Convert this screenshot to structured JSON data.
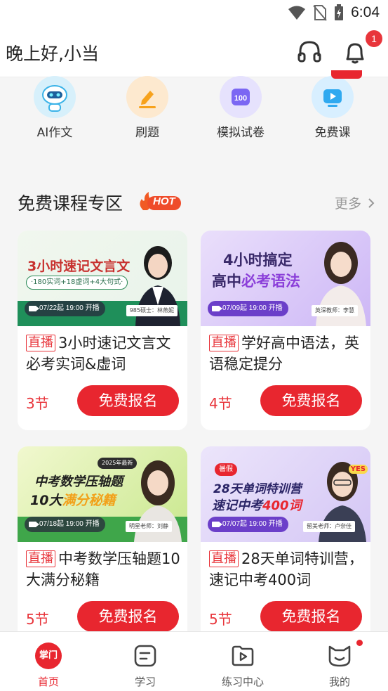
{
  "status": {
    "time": "6:04"
  },
  "header": {
    "greeting": "晚上好,小当",
    "notification_count": "1"
  },
  "quick_nav": [
    {
      "label": "AI作文",
      "icon": "robot-icon",
      "color": "#3bb3e8"
    },
    {
      "label": "刷题",
      "icon": "pen-icon",
      "color": "#f7a21c"
    },
    {
      "label": "模拟试卷",
      "icon": "score-100-icon",
      "color": "#6f5cf0"
    },
    {
      "label": "免费课",
      "icon": "play-icon",
      "color": "#29a8ef"
    }
  ],
  "section": {
    "title": "免费课程专区",
    "hot_label": "HOT",
    "more_label": "更多"
  },
  "courses": [
    {
      "banner_title": "3小时速记文言文",
      "banner_sub": "·180实词+18虚词+4大句式·",
      "date": "07/22起 19:00 开播",
      "teacher": "985硕士：林燕妮",
      "tag": "直播",
      "title": "3小时速记文言文必考实词&虚词",
      "lessons": "3节",
      "button": "免费报名"
    },
    {
      "banner_title_1": "4小时搞定",
      "banner_title_2a": "高中",
      "banner_title_2b": "必考语法",
      "date": "07/09起 19:00 开播",
      "teacher": "英深教师：李慧",
      "tag": "直播",
      "title": "学好高中语法，英语稳定提分",
      "lessons": "4节",
      "button": "免费报名"
    },
    {
      "banner_badge": "2025年最新",
      "banner_title_1": "中考数学压轴题",
      "banner_title_2a": "10大",
      "banner_title_2b": "满分秘籍",
      "date": "07/18起 19:00 开播",
      "teacher": "明星老师：刘静",
      "tag": "直播",
      "title": "中考数学压轴题10大满分秘籍",
      "lessons": "5节",
      "button": "免费报名"
    },
    {
      "banner_badge": "暑假",
      "banner_title_1": "28天单词特训营",
      "banner_title_2a": "速记中考",
      "banner_title_2b": "400词",
      "banner_yes": "YES",
      "date": "07/07起 19:00 开播",
      "teacher": "留美老师：卢奈佳",
      "tag": "直播",
      "title": "28天单词特训营，速记中考400词",
      "lessons": "5节",
      "button": "免费报名"
    }
  ],
  "bottom_nav": [
    {
      "label": "首页",
      "icon_text": "掌门",
      "active": true
    },
    {
      "label": "学习",
      "active": false
    },
    {
      "label": "练习中心",
      "active": false
    },
    {
      "label": "我的",
      "active": false
    }
  ],
  "colors": {
    "primary_red": "#e8262f",
    "badge_red": "#e8353b"
  }
}
